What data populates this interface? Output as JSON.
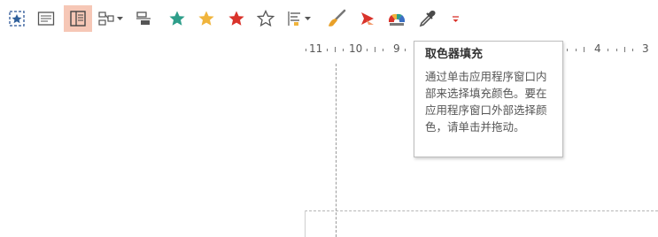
{
  "toolbar": {
    "buttons": [
      {
        "name": "select-area-button",
        "icon": "select-area-icon"
      },
      {
        "name": "text-box-button",
        "icon": "text-box-icon"
      },
      {
        "name": "layout-button",
        "icon": "layout-icon",
        "selected": true
      },
      {
        "name": "arrange-dropdown-button",
        "icon": "arrange-icon"
      },
      {
        "name": "align-button",
        "icon": "align-icon"
      },
      {
        "name": "teal-star-button",
        "icon": "star-icon",
        "color": "#2e9e8a"
      },
      {
        "name": "gold-star-button",
        "icon": "star-icon",
        "color": "#f0b43c"
      },
      {
        "name": "red-star-button",
        "icon": "star-icon",
        "color": "#d9332b"
      },
      {
        "name": "outline-star-button",
        "icon": "star-outline-icon"
      },
      {
        "name": "line-spacing-dropdown-button",
        "icon": "line-spacing-icon"
      },
      {
        "name": "format-painter-button",
        "icon": "brush-icon"
      },
      {
        "name": "shape-button",
        "icon": "shape-icon"
      },
      {
        "name": "color-wheel-button",
        "icon": "color-wheel-icon"
      },
      {
        "name": "eyedropper-button",
        "icon": "eyedropper-icon"
      },
      {
        "name": "more-dropdown-button",
        "icon": "chevron-down-icon"
      }
    ]
  },
  "ruler": {
    "left_labels": [
      "11",
      "10",
      "9"
    ],
    "right_labels": [
      "4",
      "3"
    ]
  },
  "tooltip": {
    "title": "取色器填充",
    "body": "通过单击应用程序窗口内部来选择填充颜色。要在应用程序窗口外部选择颜色，请单击并拖动。"
  }
}
